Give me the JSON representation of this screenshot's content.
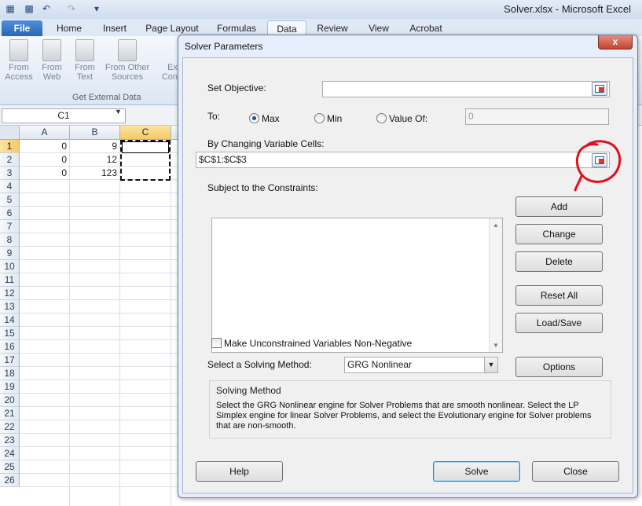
{
  "window": {
    "title": "Solver.xlsx  -  Microsoft Excel"
  },
  "ribbon": {
    "tabs": [
      "File",
      "Home",
      "Insert",
      "Page Layout",
      "Formulas",
      "Data",
      "Review",
      "View",
      "Acrobat"
    ],
    "active_tab": "Data",
    "buttons": [
      {
        "line1": "From",
        "line2": "Access"
      },
      {
        "line1": "From",
        "line2": "Web"
      },
      {
        "line1": "From",
        "line2": "Text"
      },
      {
        "line1": "From Other",
        "line2": "Sources"
      },
      {
        "line1": "Ex",
        "line2": "Con"
      }
    ],
    "group_label": "Get External Data"
  },
  "formula_bar": {
    "name_box": "C1"
  },
  "grid": {
    "columns": [
      "A",
      "B",
      "C"
    ],
    "selected_column": "C",
    "rows": [
      "1",
      "2",
      "3",
      "4",
      "5",
      "6",
      "7",
      "8",
      "9",
      "10",
      "11",
      "12",
      "13",
      "14",
      "15",
      "16",
      "17",
      "18",
      "19",
      "20",
      "21",
      "22",
      "23",
      "24",
      "25",
      "26"
    ],
    "selected_row": "1",
    "cells": [
      {
        "ref": "A1",
        "value": "0"
      },
      {
        "ref": "B1",
        "value": "9"
      },
      {
        "ref": "A2",
        "value": "0"
      },
      {
        "ref": "B2",
        "value": "12"
      },
      {
        "ref": "A3",
        "value": "0"
      },
      {
        "ref": "B3",
        "value": "123"
      }
    ]
  },
  "dialog": {
    "title": "Solver Parameters",
    "close_label": "x",
    "set_objective_label": "Set Objective:",
    "set_objective_value": "",
    "to_label": "To:",
    "radio_max": "Max",
    "radio_min": "Min",
    "radio_value_of": "Value Of:",
    "selected_goal": "Max",
    "value_of_input": "0",
    "changing_cells_label": "By Changing Variable Cells:",
    "changing_cells_value": "$C$1:$C$3",
    "constraints_label": "Subject to the Constraints:",
    "constraints": [],
    "buttons": {
      "add": "Add",
      "change": "Change",
      "delete": "Delete",
      "reset_all": "Reset All",
      "load_save": "Load/Save",
      "options": "Options",
      "help": "Help",
      "solve": "Solve",
      "close": "Close"
    },
    "nonneg_label": "Make Unconstrained Variables Non-Negative",
    "nonneg_checked": false,
    "method_label": "Select a Solving Method:",
    "method_value": "GRG Nonlinear",
    "method_group_title": "Solving Method",
    "method_description": "Select the GRG Nonlinear engine for Solver Problems that are smooth nonlinear. Select the LP Simplex engine for linear Solver Problems, and select the Evolutionary engine for Solver problems that are non-smooth."
  },
  "annotation": {
    "color": "#e0101a",
    "shape": "hand-drawn circle around reference button"
  },
  "colors": {
    "file_tab": "#2966b8",
    "selection": "#f6c965",
    "dialog_bg": "#f0f0f0"
  }
}
